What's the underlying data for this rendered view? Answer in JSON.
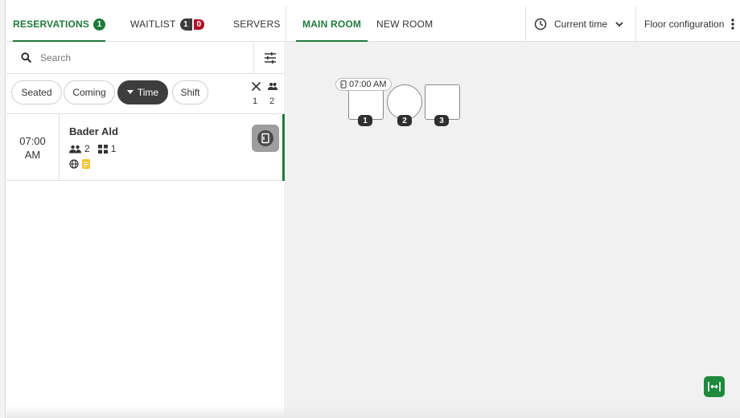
{
  "nav": {
    "reservations_label": "RESERVATIONS",
    "reservations_count": "1",
    "waitlist_label": "WAITLIST",
    "waitlist_count": "1",
    "waitlist_alert_count": "0",
    "servers_label": "SERVERS",
    "room_tabs": [
      "MAIN ROOM",
      "NEW ROOM"
    ],
    "active_room": "MAIN ROOM",
    "current_time_label": "Current time",
    "floor_config_label": "Floor configuration"
  },
  "search": {
    "placeholder": "Search",
    "value": ""
  },
  "filters": {
    "chips": [
      "Seated",
      "Coming",
      "Time",
      "Shift"
    ],
    "selected": "Time",
    "covers_count": "1",
    "guests_count": "2"
  },
  "reservation": {
    "time": "07:00",
    "ampm": "AM",
    "guest_name": "Bader Ald",
    "party_size": "2",
    "table_count": "1"
  },
  "floor": {
    "tables": [
      {
        "number": "1",
        "shape": "square"
      },
      {
        "number": "2",
        "shape": "round"
      },
      {
        "number": "3",
        "shape": "square"
      }
    ],
    "reservation_tag_time": "07:00 AM"
  },
  "colors": {
    "accent": "#1e7a3a",
    "alert": "#b3122a",
    "floor_bg": "#f1f1f1",
    "note_yellow": "#f5c232"
  },
  "icons": [
    "search-icon",
    "filter-sliders-icon",
    "clock-icon",
    "chevron-down-icon",
    "kebab-menu-icon",
    "cutlery-icon",
    "people-icon",
    "table-icon",
    "globe-icon",
    "note-icon",
    "seat-door-icon",
    "fit-width-icon"
  ]
}
